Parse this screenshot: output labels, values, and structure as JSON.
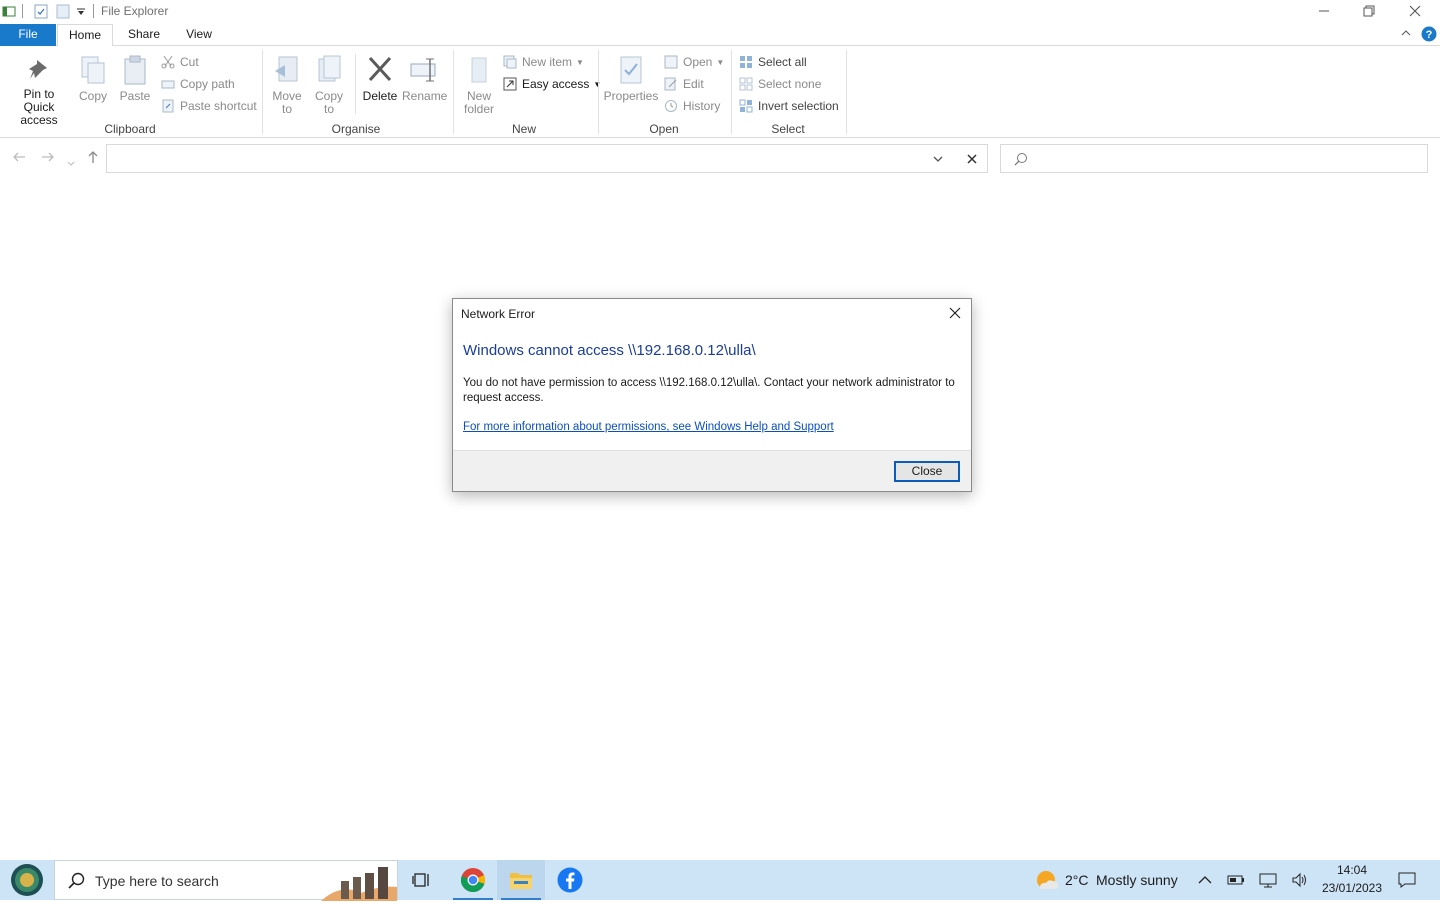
{
  "window": {
    "title": "File Explorer"
  },
  "ribbon": {
    "tabs": [
      "File",
      "Home",
      "Share",
      "View"
    ],
    "clipboard": {
      "group_label": "Clipboard",
      "pin_label": "Pin to Quick access",
      "copy_label": "Copy",
      "paste_label": "Paste",
      "cut_label": "Cut",
      "copy_path_label": "Copy path",
      "paste_shortcut_label": "Paste shortcut"
    },
    "organise": {
      "group_label": "Organise",
      "move_to_label": "Move to",
      "copy_to_label": "Copy to",
      "delete_label": "Delete",
      "rename_label": "Rename"
    },
    "new": {
      "group_label": "New",
      "new_folder_label": "New folder",
      "new_item_label": "New item",
      "easy_access_label": "Easy access"
    },
    "open": {
      "group_label": "Open",
      "properties_label": "Properties",
      "open_label": "Open",
      "edit_label": "Edit",
      "history_label": "History"
    },
    "select": {
      "group_label": "Select",
      "select_all_label": "Select all",
      "select_none_label": "Select none",
      "invert_selection_label": "Invert selection"
    }
  },
  "dialog": {
    "title": "Network Error",
    "heading": "Windows cannot access \\\\192.168.0.12\\ulla\\",
    "message": "You do not have permission to access \\\\192.168.0.12\\ulla\\. Contact your network administrator to request access.",
    "link": "For more information about permissions, see Windows Help and Support",
    "close_button": "Close"
  },
  "taskbar": {
    "search_placeholder": "Type here to search",
    "weather_temp": "2°C",
    "weather_desc": "Mostly sunny",
    "time": "14:04",
    "date": "23/01/2023"
  },
  "colors": {
    "accent": "#1979ca",
    "taskbar": "#cde4f7",
    "dialog_heading": "#1a3d9a",
    "link": "#0b4fbd"
  }
}
